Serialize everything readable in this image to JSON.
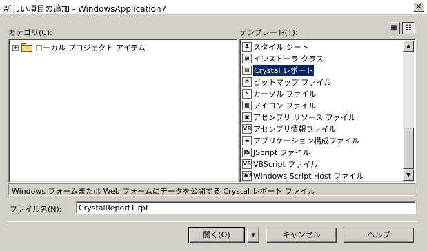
{
  "window": {
    "title": "新しい項目の追加 - WindowsApplication7",
    "close_glyph": "✕"
  },
  "categories": {
    "label": "カテゴリ(C):",
    "tree": [
      {
        "expander": "+",
        "label": "ローカル プロジェクト アイテム"
      }
    ]
  },
  "templates": {
    "label": "テンプレート(T):",
    "view_large_glyph": "▦",
    "view_small_glyph": "☷",
    "items": [
      {
        "label": "スタイル シート",
        "icon": "style-sheet-icon",
        "glyph": "A"
      },
      {
        "label": "インストーラ クラス",
        "icon": "installer-class-icon",
        "glyph": "⊞"
      },
      {
        "label": "Crystal レポート",
        "icon": "crystal-report-icon",
        "glyph": "▤",
        "selected": true
      },
      {
        "label": "ビットマップ ファイル",
        "icon": "bitmap-icon",
        "glyph": "✿"
      },
      {
        "label": "カーソル ファイル",
        "icon": "cursor-icon",
        "glyph": "↖"
      },
      {
        "label": "アイコン ファイル",
        "icon": "icon-file-icon",
        "glyph": "▦"
      },
      {
        "label": "アセンブリ リソース ファイル",
        "icon": "resource-file-icon",
        "glyph": "▣"
      },
      {
        "label": "アセンブリ情報ファイル",
        "icon": "assembly-info-icon",
        "glyph": "VB"
      },
      {
        "label": "アプリケーション構成ファイル",
        "icon": "config-file-icon",
        "glyph": "≡"
      },
      {
        "label": "JScript ファイル",
        "icon": "jscript-icon",
        "glyph": "JS"
      },
      {
        "label": "VBScript ファイル",
        "icon": "vbscript-icon",
        "glyph": "VS"
      },
      {
        "label": "Windows Script Host ファイル",
        "icon": "wsh-icon",
        "glyph": "WS"
      }
    ],
    "scroll_up_glyph": "▲",
    "scroll_down_glyph": "▼"
  },
  "description": "Windows フォームまたは Web フォームにデータを公開する Crystal レポート ファイル",
  "filename": {
    "label": "ファイル名(N):",
    "value": "CrystalReport1.rpt"
  },
  "buttons": {
    "open": "開く(O)",
    "open_menu_glyph": "▾",
    "cancel": "キャンセル",
    "help": "ヘルプ"
  }
}
